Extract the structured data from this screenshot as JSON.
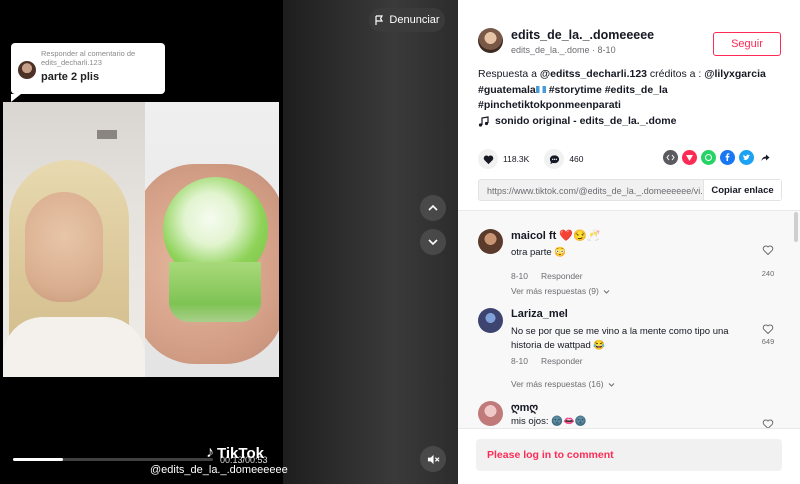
{
  "video": {
    "report_label": "Denunciar",
    "reply_card": {
      "header": "Responder al comentario de edits_decharli.123",
      "text": "parte 2 plis"
    },
    "watermark_small": "TikTok",
    "brand": "TikTok",
    "handle": "@edits_de_la._.domeeeeee",
    "time": "00:13/00:53",
    "progress": 0.25
  },
  "author": {
    "username": "edits_de_la._.domeeeee",
    "subline": "edits_de_la._.dome · 8-10",
    "follow_label": "Seguir"
  },
  "description": {
    "prefix": "Respuesta a ",
    "mention1": "@editss_decharli.123",
    "middle": " créditos a : ",
    "mention2": "@lilyxgarcia",
    "hashtags_line1": "#guatemala",
    "hashtags_line1b": " #storytime #edits_de_la",
    "hashtags_line2": "#pinchetiktokponmeenparati"
  },
  "sound": "sonido original - edits_de_la._.dome",
  "stats": {
    "likes": "118.3K",
    "comments": "460"
  },
  "share": {
    "url": "https://www.tiktok.com/@edits_de_la._.domeeeeee/vi...",
    "copy_label": "Copiar enlace"
  },
  "comments": [
    {
      "name": "maicol ft ❤️😏🥂",
      "text": "otra parte 😳",
      "date": "8-10",
      "reply": "Responder",
      "likes": "240",
      "more": "Ver más respuestas (9)"
    },
    {
      "name": "Lariza_mel",
      "text": "No se por que se me vino a la mente como tipo una historia de wattpad 😂",
      "date": "8-10",
      "reply": "Responder",
      "likes": "649",
      "more": "Ver más respuestas (16)"
    },
    {
      "name": "ღmღ",
      "text": "mis ojos: 🌚👄🌚",
      "date": "",
      "reply": "",
      "likes": "",
      "more": ""
    }
  ],
  "login_prompt": "Please log in to comment",
  "colors": {
    "accent": "#fe2c55",
    "text": "#161823",
    "muted": "#6d6d72"
  }
}
